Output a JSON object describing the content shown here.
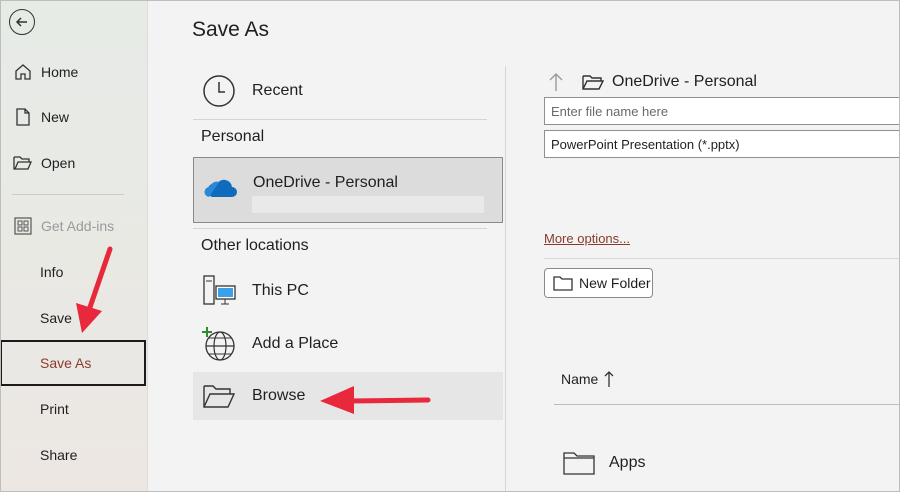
{
  "page": {
    "title": "Save As"
  },
  "sidebar": {
    "items": [
      {
        "label": "Home",
        "icon": "home-icon"
      },
      {
        "label": "New",
        "icon": "new-document-icon"
      },
      {
        "label": "Open",
        "icon": "open-folder-icon"
      },
      {
        "label": "Get Add-ins",
        "icon": "add-ins-icon",
        "disabled": true
      },
      {
        "label": "Info"
      },
      {
        "label": "Save"
      },
      {
        "label": "Save As",
        "selected": true
      },
      {
        "label": "Print"
      },
      {
        "label": "Share"
      }
    ]
  },
  "locations": {
    "recent": "Recent",
    "personal_heading": "Personal",
    "onedrive": "OneDrive - Personal",
    "other_heading": "Other locations",
    "this_pc": "This PC",
    "add_place": "Add a Place",
    "browse": "Browse"
  },
  "right_pane": {
    "path": "OneDrive - Personal",
    "filename_placeholder": "Enter file name here",
    "file_type": "PowerPoint Presentation (*.pptx)",
    "more_options": "More options...",
    "new_folder": "New Folder",
    "column_name": "Name",
    "sort_direction": "ascending",
    "rows": [
      {
        "name": "Apps",
        "icon": "folder-icon"
      }
    ]
  },
  "colors": {
    "accent": "#8a3b2a",
    "annotation": "#e8283b",
    "onedrive": "#0f6cbd"
  }
}
